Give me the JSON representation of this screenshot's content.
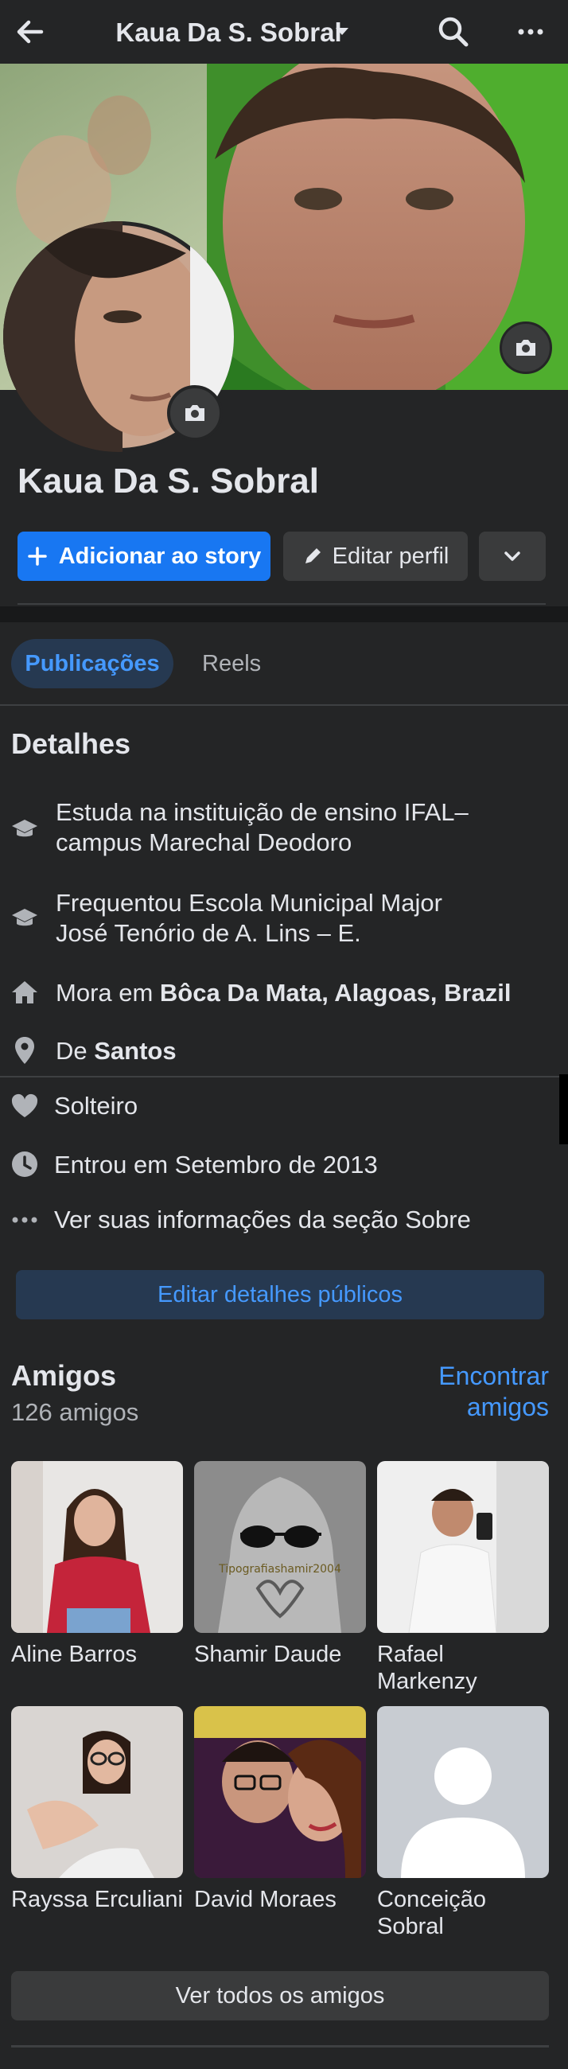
{
  "header": {
    "title": "Kaua Da S. Sobral"
  },
  "profile": {
    "name": "Kaua Da S. Sobral",
    "add_story_label": "Adicionar ao story",
    "edit_profile_label": "Editar perfil"
  },
  "tabs": [
    {
      "label": "Publicações",
      "active": true
    },
    {
      "label": "Reels",
      "active": false
    }
  ],
  "details": {
    "heading": "Detalhes",
    "items": [
      {
        "icon": "graduation-cap-icon",
        "text": "Estuda na instituição de ensino IFAL–\ncampus Marechal Deodoro"
      },
      {
        "icon": "graduation-cap-icon",
        "text": "Frequentou Escola Municipal Major\nJosé Tenório de A. Lins – E."
      },
      {
        "icon": "house-icon",
        "prefix": "Mora em ",
        "bold": "Bôca Da Mata, Alagoas, Brazil"
      },
      {
        "icon": "location-pin-icon",
        "prefix": "De ",
        "bold": "Santos"
      },
      {
        "icon": "heart-icon",
        "text": "Solteiro"
      },
      {
        "icon": "clock-icon",
        "text": "Entrou em Setembro de 2013"
      },
      {
        "icon": "ellipsis-icon",
        "text": "Ver suas informações da seção Sobre"
      }
    ],
    "edit_public_label": "Editar detalhes públicos"
  },
  "friends": {
    "heading": "Amigos",
    "count": "126 amigos",
    "find_label": "Encontrar amigos",
    "items": [
      {
        "name": "Aline Barros"
      },
      {
        "name": "Shamir Daude"
      },
      {
        "name": "Rafael Markenzy"
      },
      {
        "name": "Rayssa Erculiani"
      },
      {
        "name": "David Moraes"
      },
      {
        "name": "Conceição Sobral"
      }
    ],
    "photo_overlay_text": "Tipografiashamir2004",
    "see_all_label": "Ver todos os amigos"
  },
  "colors": {
    "background": "#242526",
    "accent": "#1877f2",
    "link": "#4599ff",
    "secondary_button": "#3a3b3c"
  }
}
